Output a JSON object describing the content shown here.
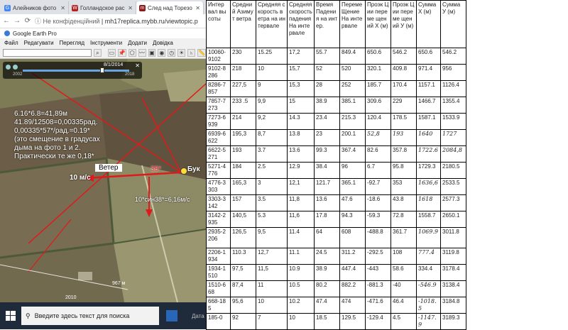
{
  "browser": {
    "tabs": [
      {
        "label": "Алейников фото",
        "favicon": "G",
        "color": "#4285f4",
        "active": false
      },
      {
        "label": "Голландское рас",
        "favicon": "W",
        "color": "#b22222",
        "active": false
      },
      {
        "label": "След над Торезо",
        "favicon": "m",
        "color": "#8b1a1a",
        "active": true
      }
    ],
    "security": "Не конфіденційний",
    "url": "mh17replica.mybb.ru/viewtopic.p"
  },
  "earth": {
    "title": "Google Earth Pro",
    "menu": [
      "Файл",
      "Редагувати",
      "Перегляд",
      "Інструменти",
      "Додати",
      "Довідка"
    ]
  },
  "timeslider": {
    "date": "8/1/2014",
    "start_year": "2002",
    "end_year": "2018"
  },
  "annotations": {
    "calc": [
      "6.16*6.8=41,89м",
      "41.89/12508=0,00335рад.",
      "0,00335*57*/рад.=0.19*",
      "(это смещение в градусах",
      "дыма на фото 1 и 2.",
      "Практически те же 0,18*"
    ],
    "wind_label": "Ветер",
    "wind_speed": "10 м/с",
    "angle": "38*",
    "buk": "Бук",
    "component": "10*син38*=6,16м/с"
  },
  "map": {
    "scale": "967 м",
    "logo_year": "2010"
  },
  "taskbar": {
    "search_placeholder": "Введите здесь текст для поиска",
    "tray_note": "Дата"
  },
  "table": {
    "headers": [
      "Интер вал высоты",
      "Средний Азимут ветра",
      "Средняя скорость ветра на интервале",
      "Средняя скорость падения На инте рвале",
      "Время Падения на интер.",
      "Переме Щение На инте рвале",
      "Проэк Ции переме щений Х (м)",
      "Проэк Ции переме щений У (м)",
      "Сумма Х (м)",
      "Сумма У (м)"
    ],
    "rows": [
      [
        "10060-9102",
        "230",
        "15.25",
        "17,2",
        "55.7",
        "849.4",
        "650.6",
        "546.2",
        "650.6",
        "546.2"
      ],
      [
        "9102-8286",
        "218",
        "10",
        "15,7",
        "52",
        "520",
        "320.1",
        "409.8",
        "971.4",
        "956"
      ],
      [
        "8286-7857",
        "227,5",
        "9",
        "15,3",
        "28",
        "252",
        "185.7",
        "170.4",
        "1157.1",
        "1126.4"
      ],
      [
        "7857-7273",
        "233 .5",
        "9,9",
        "15",
        "38.9",
        "385.1",
        "309.6",
        "229",
        "1466.7",
        "1355.4"
      ],
      [
        "7273-6939",
        "214",
        "9,2",
        "14.3",
        "23.4",
        "215.3",
        "120.4",
        "178.5",
        "1587.1",
        "1533.9"
      ],
      [
        "6939-6622",
        "195,3",
        "8,7",
        "13.8",
        "23",
        "200.1",
        "52,8",
        "193",
        "1640",
        "1727"
      ],
      [
        "6622-5271",
        "193",
        "3.7",
        "13.6",
        "99.3",
        "367.4",
        "82.6",
        "357.8",
        "1722.6",
        "2084,8"
      ],
      [
        "5271-4776",
        "184",
        "2.5",
        "12.9",
        "38.4",
        "96",
        "6.7",
        "95.8",
        "1729.3",
        "2180.5"
      ],
      [
        "4776-3303",
        "165,3",
        "3",
        "12,1",
        "121.7",
        "365.1",
        "-92.7",
        "353",
        "1636,6",
        "2533.5"
      ],
      [
        "3303-3142",
        "157",
        "3.5",
        "11,8",
        "13.6",
        "47.6",
        "-18.6",
        "43.8",
        "1618",
        "2577.3"
      ],
      [
        "3142-2935",
        "140,5",
        "5.3",
        "11,6",
        "17.8",
        "94.3",
        "-59.3",
        "72.8",
        "1558.7",
        "2650.1"
      ],
      [
        "2935-2206",
        "126,5",
        "9,5",
        "11.4",
        "64",
        "608",
        "-488.8",
        "361.7",
        "1069.9",
        "3011.8"
      ],
      [
        "2206-1934",
        "110.3",
        "12,7",
        "11.1",
        "24.5",
        "311.2",
        "-292.5",
        "108",
        "777.4",
        "3119.8"
      ],
      [
        "1934-1510",
        "97,5",
        "11,5",
        "10.9",
        "38.9",
        "447.4",
        "-443",
        "58.6",
        "334.4",
        "3178.4"
      ],
      [
        "1510-668",
        "87,4",
        "11",
        "10.5",
        "80.2",
        "882.2",
        "-881.3",
        "-40",
        "-546.9",
        "3138.4"
      ],
      [
        "668-185",
        "95,6",
        "10",
        "10.2",
        "47.4",
        "474",
        "-471.6",
        "46.4",
        "-1018.5",
        "3184.8"
      ],
      [
        "185-0",
        "92",
        "7",
        "10",
        "18.5",
        "129.5",
        "-129.4",
        "4.5",
        "-1147.9",
        "3189.3"
      ]
    ]
  }
}
